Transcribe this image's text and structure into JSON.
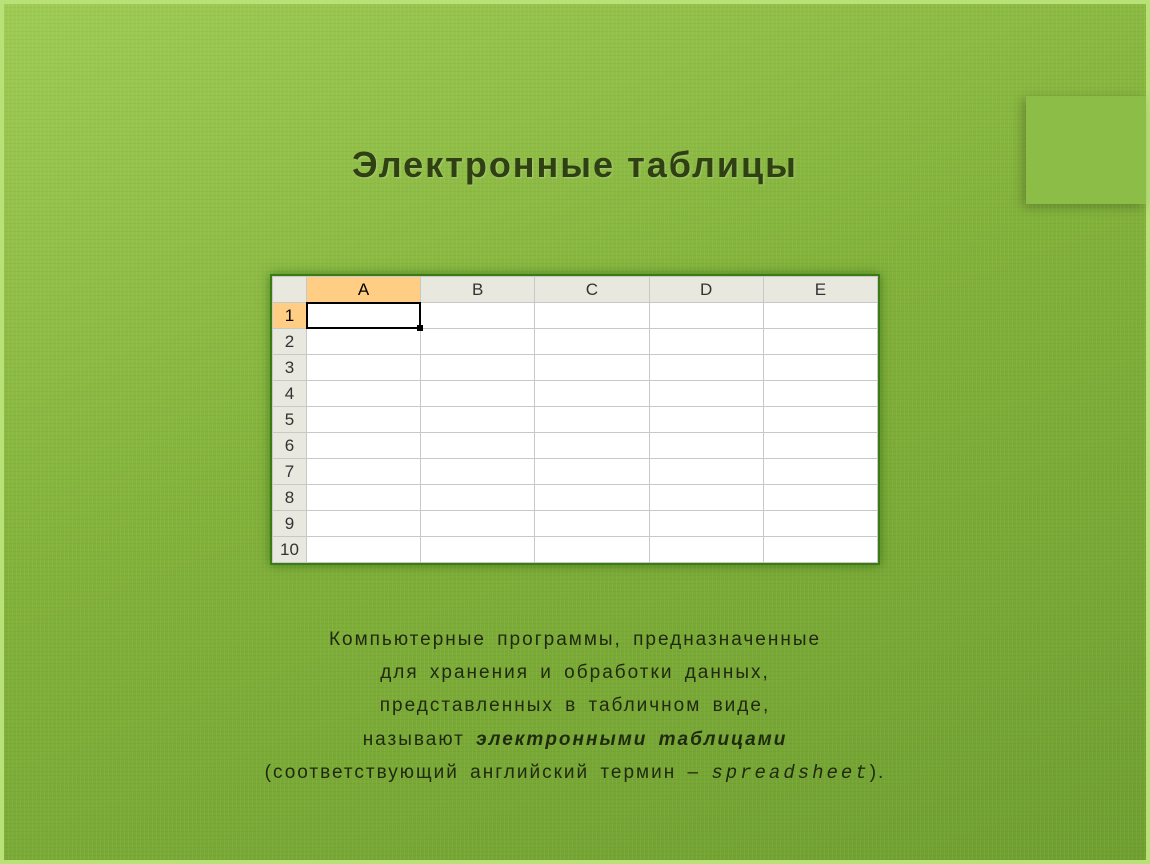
{
  "title": "Электронные  таблицы",
  "sheet": {
    "columns": [
      "A",
      "B",
      "C",
      "D",
      "E"
    ],
    "rows": [
      "1",
      "2",
      "3",
      "4",
      "5",
      "6",
      "7",
      "8",
      "9",
      "10"
    ],
    "selectedColumn": "A",
    "selectedRow": "1"
  },
  "caption": {
    "line1": "Компьютерные программы, предназначенные",
    "line2": "для хранения и обработки данных,",
    "line3": "представленных в табличном виде,",
    "line4_prefix": "называют ",
    "line4_emph": "электронными таблицами",
    "line5_prefix": "(соответствующий английский термин – ",
    "line5_term": "spreadsheet",
    "line5_suffix": ")."
  }
}
